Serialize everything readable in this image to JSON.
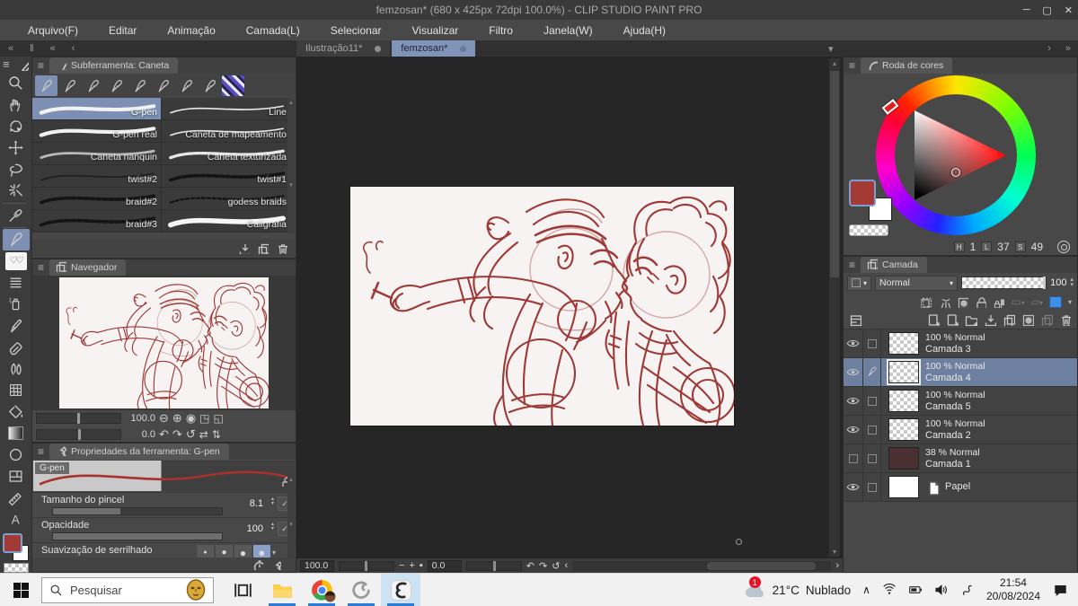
{
  "window": {
    "title": "femzosan* (680 x 425px 72dpi 100.0%)  - CLIP STUDIO PAINT PRO"
  },
  "menu": {
    "items": [
      "Arquivo(F)",
      "Editar",
      "Animação",
      "Camada(L)",
      "Selecionar",
      "Visualizar",
      "Filtro",
      "Janela(W)",
      "Ajuda(H)"
    ]
  },
  "tabs": {
    "items": [
      {
        "label": "Ilustração11*",
        "active": false
      },
      {
        "label": "femzosan*",
        "active": true
      }
    ]
  },
  "toolbar": {
    "tools": [
      {
        "name": "zoom-tool",
        "icon": "zoom"
      },
      {
        "name": "hand-tool",
        "icon": "hand"
      },
      {
        "name": "rotate-canvas-tool",
        "icon": "rotate"
      },
      {
        "name": "move-tool",
        "icon": "move"
      },
      {
        "name": "lasso-tool",
        "icon": "lasso"
      },
      {
        "name": "auto-select-tool",
        "icon": "wand"
      },
      {
        "name": "eyedropper-tool",
        "icon": "dropper"
      },
      {
        "name": "pen-tool",
        "icon": "pen",
        "selected": true
      },
      {
        "name": "decoration-tool",
        "icon": "deco"
      },
      {
        "name": "figure-tool",
        "icon": "lines"
      },
      {
        "name": "airbrush-tool",
        "icon": "spray"
      },
      {
        "name": "brush-tool",
        "icon": "marker"
      },
      {
        "name": "eraser-tool",
        "icon": "eraser"
      },
      {
        "name": "blend-tool",
        "icon": "blend"
      },
      {
        "name": "liquify-tool",
        "icon": "mesh"
      },
      {
        "name": "fill-tool",
        "icon": "bucket"
      },
      {
        "name": "gradient-tool",
        "icon": "grad"
      },
      {
        "name": "shape-tool",
        "icon": "circ"
      },
      {
        "name": "frame-tool",
        "icon": "frame"
      },
      {
        "name": "ruler-tool",
        "icon": "ruler"
      },
      {
        "name": "text-tool",
        "icon": "textA"
      }
    ]
  },
  "subtool": {
    "panel_title": "Subferramenta: Caneta",
    "pen_type_count": 8,
    "brushes": [
      {
        "label": "G-pen",
        "selected": true,
        "style": "white-taper"
      },
      {
        "label": "Line",
        "style": "white-thin"
      },
      {
        "label": "G-pen real",
        "style": "white-taper"
      },
      {
        "label": "Caneta de mapeamento",
        "style": "white-thin"
      },
      {
        "label": "Caneta nanquin",
        "style": "gray"
      },
      {
        "label": "Caneta texturizada",
        "style": "white-textured"
      },
      {
        "label": "twist#2",
        "style": "dark-thin"
      },
      {
        "label": "twist#1",
        "style": "dark-chain"
      },
      {
        "label": "braid#2",
        "style": "dark-chain"
      },
      {
        "label": "godess braids",
        "style": "dark-chain-thin"
      },
      {
        "label": "braid#3",
        "style": "dark-chain"
      },
      {
        "label": "Caligrafia",
        "style": "white-thick"
      }
    ]
  },
  "navigator": {
    "panel_title": "Navegador",
    "zoom_value": "100.0",
    "rotate_value": "0.0"
  },
  "properties": {
    "panel_title": "Propriedades da ferramenta: G-pen",
    "preview_label": "G-pen",
    "rows": [
      {
        "label": "Tamanho do pincel",
        "value": "8.1",
        "fill": 40
      },
      {
        "label": "Opacidade",
        "value": "100",
        "fill": 100
      }
    ],
    "aa_label": "Suavização de serrilhado"
  },
  "color_wheel": {
    "panel_title": "Roda de cores",
    "hls": [
      {
        "key": "H",
        "value": "1"
      },
      {
        "key": "L",
        "value": "37"
      },
      {
        "key": "S",
        "value": "49"
      }
    ],
    "foreground_color": "#a43a36",
    "background_color": "#ffffff"
  },
  "layers": {
    "panel_title": "Camada",
    "blend_mode": "Normal",
    "opacity": "100",
    "items": [
      {
        "opacity": "100 %",
        "mode": "Normal",
        "name": "Camada 3",
        "visible": true,
        "thumb": "checker"
      },
      {
        "opacity": "100 %",
        "mode": "Normal",
        "name": "Camada 4",
        "visible": true,
        "selected": true,
        "editing": true,
        "thumb": "checker"
      },
      {
        "opacity": "100 %",
        "mode": "Normal",
        "name": "Camada 5",
        "visible": true,
        "thumb": "checker"
      },
      {
        "opacity": "100 %",
        "mode": "Normal",
        "name": "Camada 2",
        "visible": true,
        "thumb": "checker"
      },
      {
        "opacity": "38 %",
        "mode": "Normal",
        "name": "Camada 1",
        "visible": false,
        "thumb": "dark"
      },
      {
        "name": "Papel",
        "visible": true,
        "paper": true,
        "thumb": "paper"
      }
    ]
  },
  "canvas": {
    "zoom": "100.0",
    "rotation": "0.0"
  },
  "taskbar": {
    "search_placeholder": "Pesquisar",
    "weather_temp": "21°C",
    "weather_cond": "Nublado",
    "badge": "1",
    "time": "21:54",
    "date": "20/08/2024"
  },
  "colors": {
    "accent_tab": "#8094b8",
    "sketch_red": "#9e3936",
    "taskbar_active_underline": "#2b7cd8"
  }
}
